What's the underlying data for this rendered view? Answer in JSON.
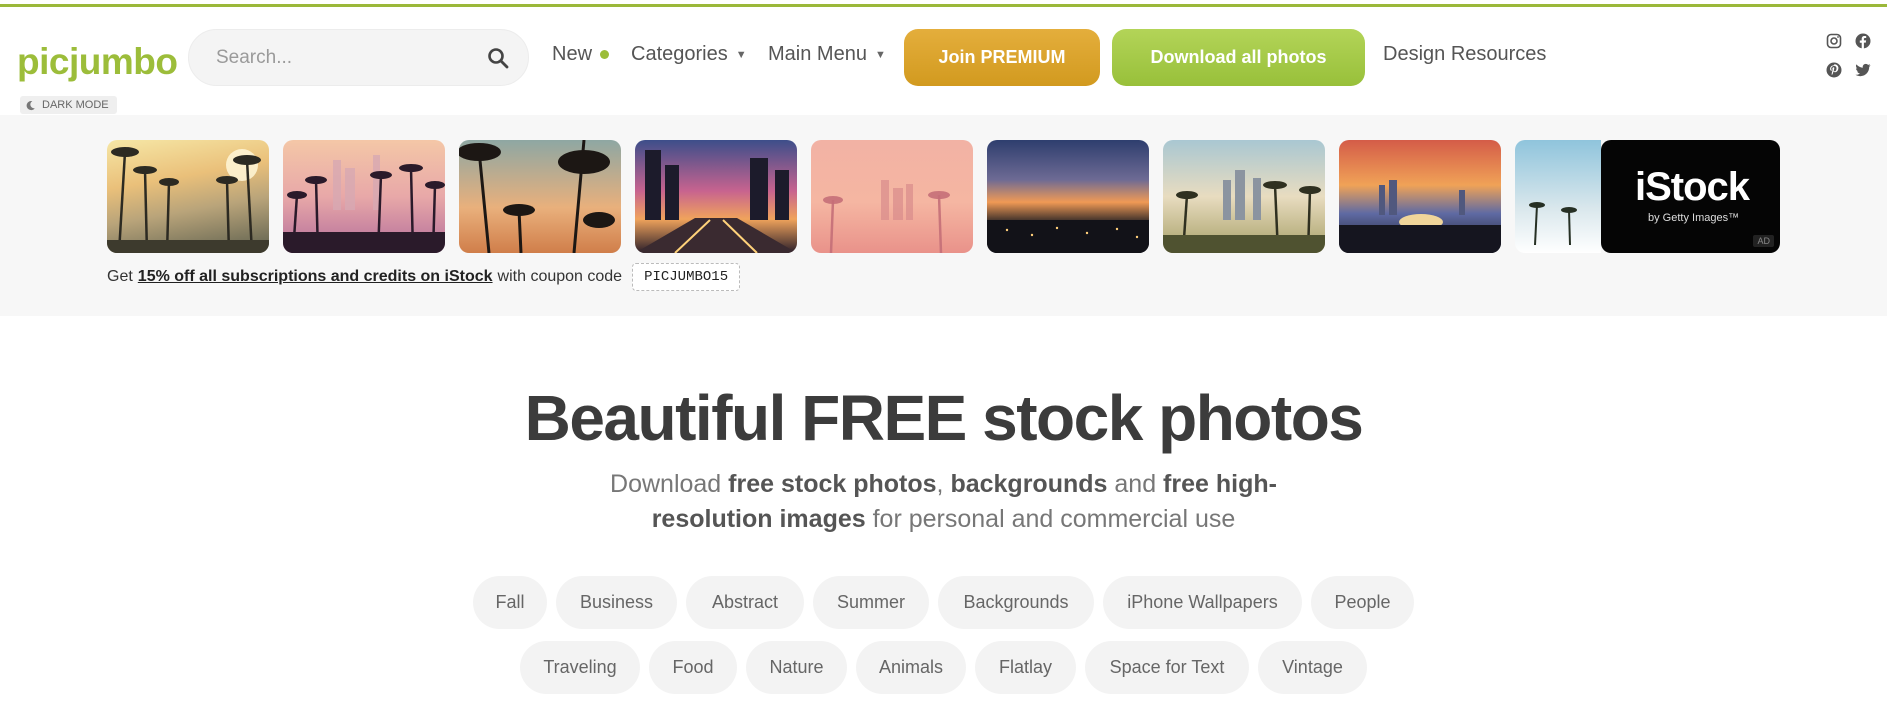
{
  "brand": {
    "logo": "picjumbo",
    "accent": "#9cbd3a"
  },
  "search": {
    "placeholder": "Search..."
  },
  "nav": {
    "new": "New",
    "categories": "Categories",
    "main_menu": "Main Menu",
    "design_resources": "Design Resources"
  },
  "buttons": {
    "premium": "Join PREMIUM",
    "download": "Download all photos"
  },
  "dark_mode": "DARK MODE",
  "ad": {
    "istock_title": "iStock",
    "istock_subtitle": "by Getty Images™",
    "ad_label": "AD",
    "coupon_prefix": "Get",
    "coupon_link": "15% off all subscriptions and credits on iStock",
    "coupon_middle": "with coupon code",
    "coupon_code": "PICJUMBO15"
  },
  "hero": {
    "title": "Beautiful FREE stock photos",
    "sub_1": "Download ",
    "sub_2": "free stock photos",
    "sub_3": ", ",
    "sub_4": "backgrounds",
    "sub_5": " and ",
    "sub_6": "free high-resolution images",
    "sub_7": " for personal and commercial use"
  },
  "tags_row1": [
    "Fall",
    "Business",
    "Abstract",
    "Summer",
    "Backgrounds",
    "iPhone Wallpapers",
    "People"
  ],
  "tags_row2": [
    "Traveling",
    "Food",
    "Nature",
    "Animals",
    "Flatlay",
    "Space for Text",
    "Vintage"
  ]
}
